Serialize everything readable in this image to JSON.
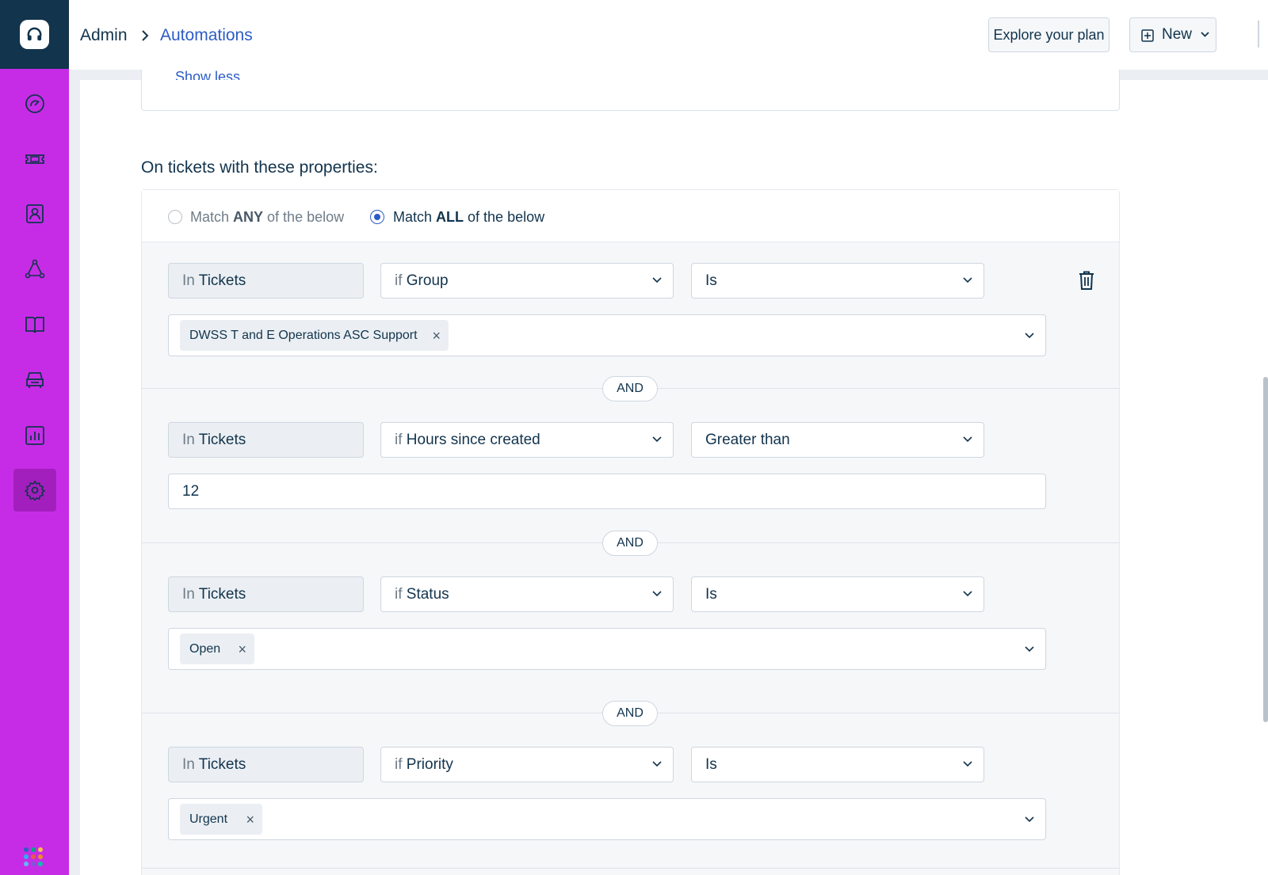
{
  "header": {
    "breadcrumb_root": "Admin",
    "breadcrumb_current": "Automations",
    "explore_label": "Explore your plan",
    "new_label": "New"
  },
  "sidebar": {
    "items": [
      {
        "icon": "dashboard-icon"
      },
      {
        "icon": "tickets-icon"
      },
      {
        "icon": "contacts-icon"
      },
      {
        "icon": "social-icon"
      },
      {
        "icon": "solutions-icon"
      },
      {
        "icon": "assets-icon"
      },
      {
        "icon": "analytics-icon"
      },
      {
        "icon": "admin-gear-icon",
        "active": true
      }
    ],
    "accent_color": "#c62ce6"
  },
  "main": {
    "show_less_label": "Show less",
    "section_title": "On tickets with these properties:",
    "match_any": {
      "pre": "Match ",
      "bold": "ANY",
      "post": " of the below",
      "checked": false
    },
    "match_all": {
      "pre": "Match ",
      "bold": "ALL",
      "post": " of the below",
      "checked": true
    },
    "and_label": "AND",
    "conditions": [
      {
        "in_prefix": "In",
        "in_value": "Tickets",
        "if_prefix": "if",
        "field": "Group",
        "operator": "Is",
        "chips": [
          "DWSS T and E Operations ASC Support"
        ]
      },
      {
        "in_prefix": "In",
        "in_value": "Tickets",
        "if_prefix": "if",
        "field": "Hours since created",
        "operator": "Greater than",
        "value": "12"
      },
      {
        "in_prefix": "In",
        "in_value": "Tickets",
        "if_prefix": "if",
        "field": "Status",
        "operator": "Is",
        "chips": [
          "Open"
        ]
      },
      {
        "in_prefix": "In",
        "in_value": "Tickets",
        "if_prefix": "if",
        "field": "Priority",
        "operator": "Is",
        "chips": [
          "Urgent"
        ]
      }
    ],
    "chip_remove": "×"
  }
}
